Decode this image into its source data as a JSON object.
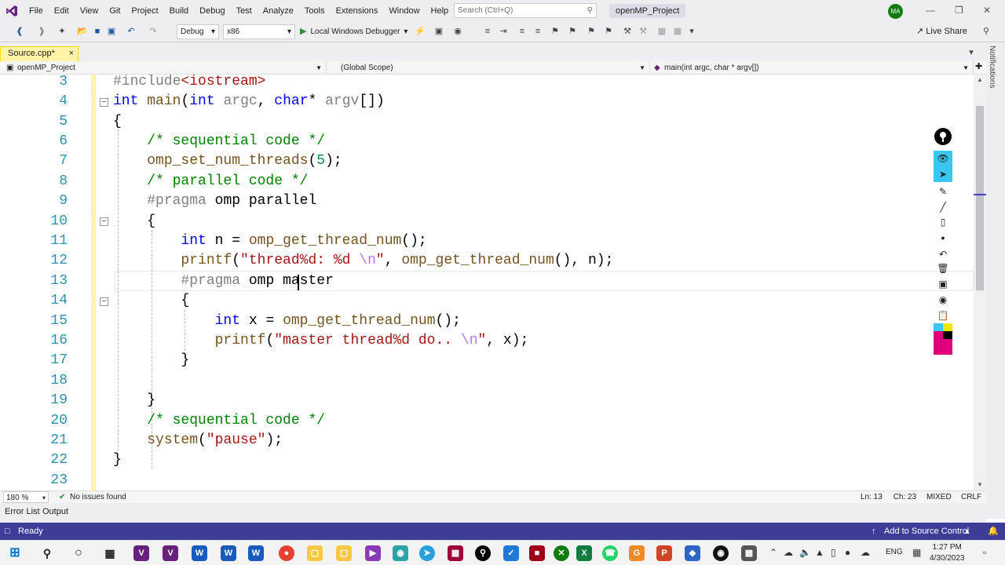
{
  "menu": {
    "items": [
      "File",
      "Edit",
      "View",
      "Git",
      "Project",
      "Build",
      "Debug",
      "Test",
      "Analyze",
      "Tools",
      "Extensions",
      "Window",
      "Help"
    ],
    "search_placeholder": "Search (Ctrl+Q)",
    "project_title": "openMP_Project",
    "avatar_initials": "MA"
  },
  "toolbar": {
    "config": "Debug",
    "platform": "x86",
    "debugger": "Local Windows Debugger",
    "live_share": "Live Share"
  },
  "tab": {
    "name": "Source.cpp*",
    "close": "×"
  },
  "navbar": {
    "project": "openMP_Project",
    "scope": "(Global Scope)",
    "member": "main(int argc, char * argv[])"
  },
  "side": {
    "notifications": "Notifications"
  },
  "editor": {
    "line_numbers": [
      "3",
      "4",
      "5",
      "6",
      "7",
      "8",
      "9",
      "10",
      "11",
      "12",
      "13",
      "14",
      "15",
      "16",
      "17",
      "18",
      "19",
      "20",
      "21",
      "22",
      "23"
    ],
    "lines": [
      "#include<iostream>",
      "int main(int argc, char* argv[])",
      "{",
      "    /* sequential code */",
      "    omp_set_num_threads(5);",
      "    /* parallel code */",
      "    #pragma omp parallel",
      "    {",
      "        int n = omp_get_thread_num();",
      "        printf(\"thread%d: %d \\n\", omp_get_thread_num(), n);",
      "        #pragma omp master",
      "        {",
      "            int x = omp_get_thread_num();",
      "            printf(\"master thread%d do.. \\n\", x);",
      "        }",
      "",
      "    }",
      "    /* sequential code */",
      "    system(\"pause\");",
      "}",
      ""
    ]
  },
  "edstatus": {
    "zoom": "180 %",
    "issues": "No issues found",
    "position": "Ln: 13     Ch: 23",
    "encoding": "MIXED",
    "eol": "CRLF"
  },
  "panels": {
    "error_list": "Error List",
    "output": "Output"
  },
  "statusbar": {
    "ready": "Ready",
    "source_control": "Add to Source Control"
  },
  "taskbar": {
    "lang": "ENG",
    "time": "1:27 PM",
    "date": "4/30/2023"
  },
  "colors": {
    "accent": "#68217a",
    "status": "#3d3d99",
    "yellow_margin": "#fff3a8"
  }
}
